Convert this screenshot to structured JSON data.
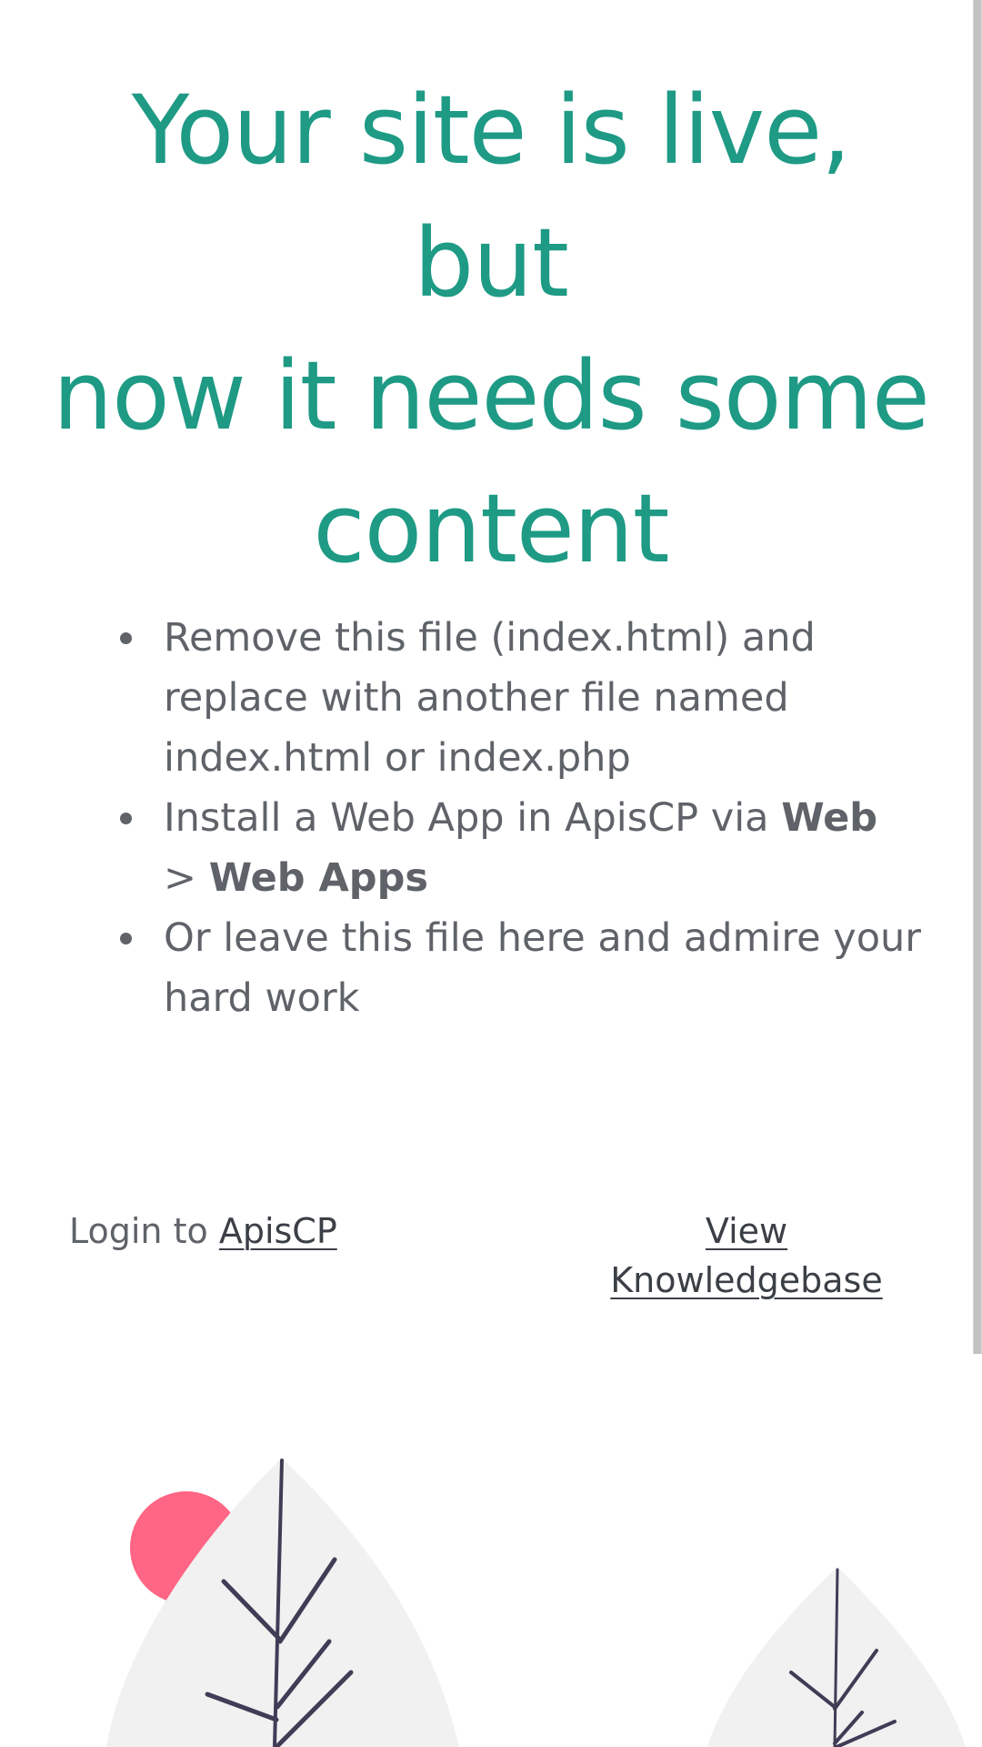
{
  "heading": {
    "line1": "Your site is live, but",
    "line2": "now it needs some",
    "line3": "content"
  },
  "instructions": [
    {
      "text": "Remove this file (index.html) and replace with another file named index.html or index.php"
    },
    {
      "prefix": "Install a Web App in ApisCP via ",
      "bold1": "Web",
      "separator": " > ",
      "bold2": "Web Apps"
    },
    {
      "text": "Or leave this file here and admire your hard work"
    }
  ],
  "footer": {
    "login_prefix": "Login to ",
    "login_link": "ApisCP",
    "kb_link": "View Knowledgebase"
  },
  "colors": {
    "accent": "#1e9a85",
    "text": "#5f6369",
    "link": "#3b3f46",
    "sun": "#ff6584",
    "leaf": "#f1f1f1",
    "branch": "#3f3d56"
  },
  "icons": {
    "bullet": "bullet-dot",
    "sun": "sun-circle",
    "tree": "leaf-tree"
  }
}
